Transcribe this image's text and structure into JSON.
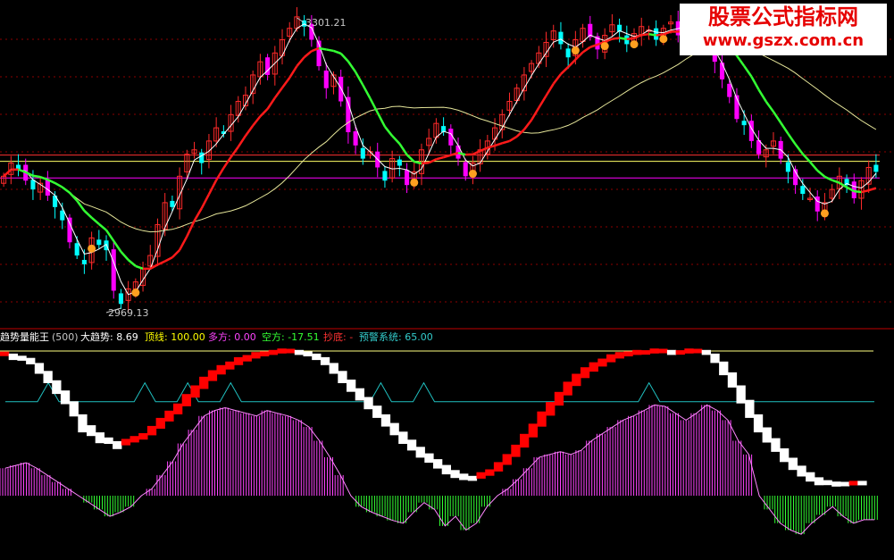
{
  "colors": {
    "background": "#000000",
    "grid": "#8b0000",
    "up_candle": "#ff2a2a",
    "down_candle": "#00ffff",
    "big_down_candle": "#ff00ff",
    "ma_thin": "#ffffff",
    "ma_red": "#ff1a1a",
    "ma_green": "#33ff33",
    "ma_yellow": "#ffff00",
    "ma_long": "#e6e69a",
    "level_red": "#ff3030",
    "level_yellow": "#ffff66",
    "level_magenta": "#ff00ff",
    "signal_orange": "#ffa020",
    "ind_white": "#ffffff",
    "ind_red": "#ff0000",
    "ind_cyan": "#20c0c0",
    "ind_hist_pos": "#ff44ff",
    "ind_hist_neg": "#33ff33",
    "ind_topline": "#ffff80"
  },
  "price_panel": {
    "high_label": "3301.21",
    "low_label": "2969.13"
  },
  "indicator_panel": {
    "name": "趋势量能王",
    "period": "(500)",
    "items": [
      {
        "label": "大趋势: 8.69",
        "color": "#ffffff"
      },
      {
        "label": "顶线: 100.00",
        "color": "#ffff00"
      },
      {
        "label": "多方: 0.00",
        "color": "#ff44ff"
      },
      {
        "label": "空方: -17.51",
        "color": "#33ff33"
      },
      {
        "label": "抄底: -",
        "color": "#ff3333"
      },
      {
        "label": "预警系统: 65.00",
        "color": "#33cccc"
      }
    ]
  },
  "watermark": {
    "title": "股票公式指标网",
    "url": "www.gszx.com.cn"
  },
  "chart_data": [
    {
      "type": "candlestick",
      "title": "",
      "x": {
        "count": 120,
        "start_index": 0
      },
      "y_range": [
        2955,
        3310
      ],
      "close": [
        3120,
        3135,
        3128,
        3115,
        3105,
        3112,
        3098,
        3085,
        3070,
        3045,
        3030,
        3020,
        3050,
        3042,
        3036,
        2990,
        2975,
        2992,
        3000,
        3015,
        3030,
        3065,
        3090,
        3085,
        3120,
        3145,
        3150,
        3135,
        3160,
        3175,
        3168,
        3190,
        3205,
        3212,
        3235,
        3250,
        3235,
        3260,
        3275,
        3288,
        3301,
        3290,
        3275,
        3245,
        3220,
        3235,
        3205,
        3170,
        3155,
        3140,
        3148,
        3130,
        3115,
        3140,
        3132,
        3110,
        3125,
        3150,
        3163,
        3180,
        3170,
        3155,
        3140,
        3120,
        3135,
        3150,
        3160,
        3175,
        3190,
        3205,
        3220,
        3235,
        3248,
        3260,
        3272,
        3285,
        3270,
        3255,
        3275,
        3288,
        3278,
        3264,
        3280,
        3292,
        3284,
        3270,
        3282,
        3290,
        3286,
        3275,
        3288,
        3295,
        3280,
        3295,
        3285,
        3275,
        3265,
        3250,
        3230,
        3210,
        3185,
        3178,
        3160,
        3145,
        3150,
        3160,
        3140,
        3125,
        3110,
        3100,
        3095,
        3080,
        3090,
        3105,
        3120,
        3110,
        3095,
        3115,
        3130,
        3125
      ],
      "level_lines": [
        3144,
        3137,
        3118
      ],
      "high_point": 3301.21,
      "low_point": 2969.13
    },
    {
      "type": "line",
      "title": "趋势量能王(500)",
      "top_line": 100,
      "warning_level": 65,
      "zero_line": 0,
      "series": [
        {
          "name": "大趋势",
          "values": [
            98,
            96,
            95,
            93,
            88,
            82,
            75,
            68,
            60,
            50,
            45,
            40,
            38,
            35,
            37,
            39,
            41,
            45,
            50,
            55,
            60,
            66,
            72,
            78,
            83,
            87,
            90,
            93,
            95,
            97,
            98,
            99,
            100,
            100,
            99,
            98,
            96,
            93,
            88,
            82,
            76,
            70,
            64,
            58,
            52,
            46,
            40,
            35,
            30,
            26,
            22,
            18,
            15,
            13,
            12,
            14,
            16,
            20,
            25,
            31,
            38,
            45,
            53,
            60,
            67,
            74,
            80,
            85,
            89,
            92,
            95,
            97,
            98,
            99,
            99,
            100,
            100,
            99,
            99,
            100,
            100,
            99,
            95,
            88,
            80,
            70,
            60,
            50,
            42,
            35,
            28,
            22,
            17,
            13,
            10,
            9,
            8,
            8,
            8.69,
            8.69
          ]
        },
        {
          "name": "多方/空方",
          "values": [
            20,
            22,
            24,
            20,
            15,
            10,
            5,
            0,
            -5,
            -10,
            -15,
            -12,
            -8,
            0,
            5,
            15,
            25,
            38,
            48,
            58,
            62,
            64,
            62,
            60,
            58,
            62,
            60,
            58,
            55,
            50,
            40,
            28,
            15,
            0,
            -8,
            -12,
            -15,
            -18,
            -20,
            -12,
            -5,
            -10,
            -22,
            -15,
            -25,
            -20,
            -8,
            0,
            5,
            12,
            20,
            28,
            30,
            32,
            30,
            33,
            40,
            45,
            50,
            55,
            58,
            62,
            66,
            65,
            60,
            55,
            60,
            66,
            62,
            55,
            40,
            30,
            0,
            -10,
            -20,
            -25,
            -28,
            -20,
            -14,
            -8,
            -15,
            -20,
            -17.51,
            -17.51
          ]
        },
        {
          "name": "预警系统",
          "values": [
            65,
            65,
            65,
            65,
            78,
            65,
            65,
            65,
            65,
            65,
            65,
            65,
            65,
            78,
            65,
            65,
            65,
            78,
            65,
            65,
            65,
            78,
            65,
            65,
            65,
            65,
            65,
            65,
            65,
            65,
            65,
            65,
            65,
            65,
            65,
            78,
            65,
            65,
            65,
            78,
            65,
            65,
            65,
            65,
            65,
            65,
            65,
            65,
            65,
            65,
            65,
            65,
            65,
            65,
            65,
            65,
            65,
            65,
            65,
            65,
            78,
            65,
            65,
            65,
            65,
            65,
            65,
            65,
            65,
            65,
            65,
            65,
            65,
            65,
            65,
            65,
            65,
            65,
            65,
            65,
            65,
            65
          ]
        }
      ]
    }
  ]
}
